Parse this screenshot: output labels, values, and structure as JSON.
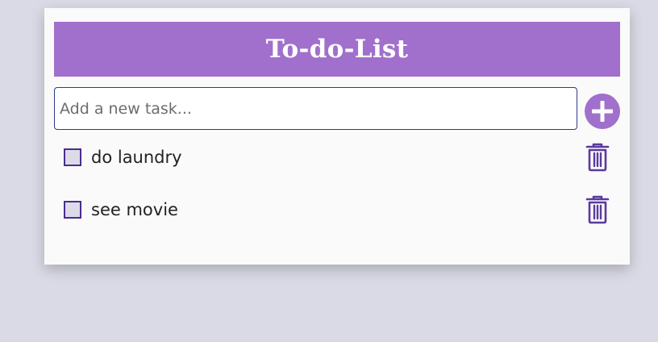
{
  "app": {
    "title": "To-do-List"
  },
  "input": {
    "placeholder": "Add a new task..."
  },
  "add_button": {
    "icon": "plus-icon"
  },
  "tasks": [
    {
      "label": "do laundry",
      "checked": false,
      "delete_icon": "trash-icon"
    },
    {
      "label": "see movie",
      "checked": false,
      "delete_icon": "trash-icon"
    }
  ],
  "colors": {
    "accent": "#a070cc",
    "checkbox_border": "#4a2d8f",
    "input_border": "#2c3a8f",
    "background": "#d9dae5"
  }
}
